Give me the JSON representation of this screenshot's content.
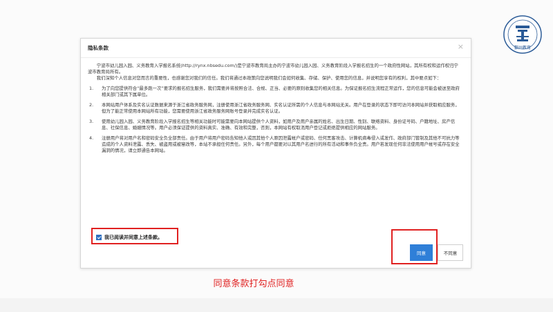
{
  "dialog": {
    "title": "隐私条款",
    "close_symbol": "×",
    "intro_1": "宁波市幼儿园入园、义务教育入学报名系统(http://rynx.nbsedu.com/)是宁波市教育局主办的宁波市幼儿园入园、义务教育阶段入学报名招生的一个政府性网站，其所有权和运作权归宁波市教育局所有。",
    "intro_2": "我们深知个人信息对您而言的重要性，也感谢您对我们的信任。我们将通过本政策向您说明我们会如何收集、存储、保护、使用您的信息，并说明您享有的权利，其中要点如下：",
    "clauses": [
      {
        "num": "1.",
        "text": "为了向您提供符合“最多跑一次”要求的报名招生服务，我们需要并将按照合法、合规、正当、必要的原则收集您的相关信息。为保证报名招生流程正常运作，您的信息可能会被送至政府相关部门或其下属单位。"
      },
      {
        "num": "2.",
        "text": "本网站用户体系及实名认证数据来源于浙江省政务服务网，注册使用浙江省政务服务网、实名认证所需的个人信息与本网站无关。用户在登录的状态下即可访问本网站并获取相应服务，但为了能正常使用本网站所有功能，您需要使用浙江省政务服务网账号登录并完成实名认证。"
      },
      {
        "num": "3.",
        "text": "使用幼儿园入园、义务教育阶段入学报名招生等相关功能时可能需要向本网站提供个人资料，如用户及用户亲属的姓名、出生日期、性别、联络资料、身份证号码、户籍地址、房产信息、社保信息、婚姻情况等。用户必须保证提供的资料真实、准确、有效和完整，否则，本网站有权取消用户登记或拒绝提供相应的网站服务。"
      },
      {
        "num": "4.",
        "text": "注册用户将对用户名和密码安全负全部责任。由于用户将用户密码告知他人或因其他个人原因泄露帐户或密码、任何黑客攻击、计算机病毒侵入或发作、政府部门管制及其他不可抗力等造成的个人资料泄露、丢失、被盗用或被窜改等，本站不承担任何责任。另外，每个用户都要对以其用户名进行的所有活动和事件负全责。用户若发现任何非法使用用户帐号或存在安全漏洞的情况，请立即通告本网站。"
      }
    ],
    "agree_checkbox_label": "我已阅读并同意上述条款。",
    "agree_button": "同意",
    "disagree_button": "不同意"
  },
  "logo": {
    "caption": "鄞州教育"
  },
  "caption": "同意条款打勾点同意",
  "colors": {
    "accent": "#2f7fd8",
    "highlight": "#e02020",
    "logo": "#2b5b97"
  }
}
